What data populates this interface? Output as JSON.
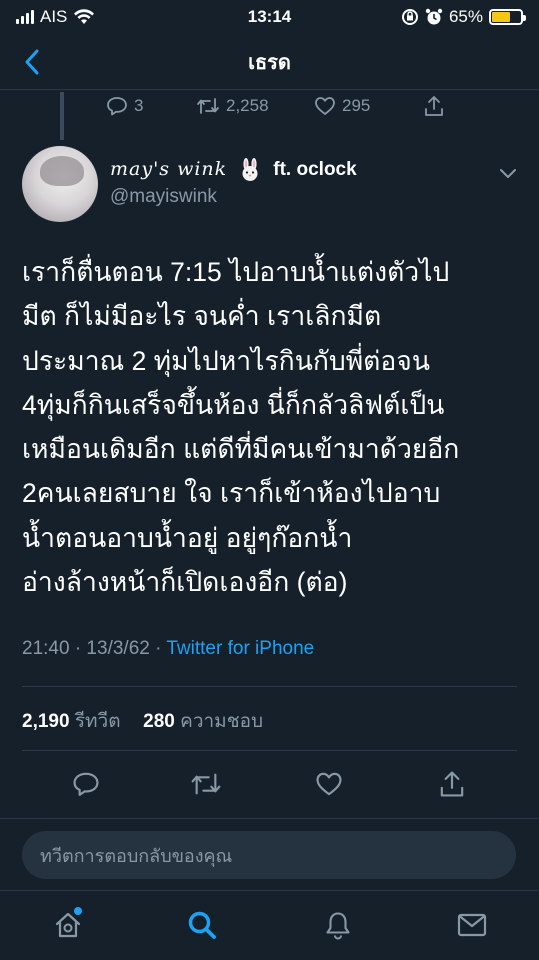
{
  "status_bar": {
    "carrier": "AIS",
    "time": "13:14",
    "battery_percent": "65%",
    "battery_level": 0.65,
    "battery_color": "#f5c518"
  },
  "nav": {
    "title": "เธรด",
    "back_icon": "chevron-left-icon"
  },
  "previous_tweet": {
    "replies": "3",
    "retweets": "2,258",
    "likes": "295"
  },
  "tweet": {
    "display_name": "may's wink",
    "display_name_suffix": "ft. oclock",
    "emoji": "rabbit-icon",
    "handle": "@mayiswink",
    "text": "เราก็ตื่นตอน 7:15 ไปอาบน้ำแต่งตัวไป\nมีต ก็ไม่มีอะไร จนค่ำ เราเลิกมีต\nประมาณ 2 ทุ่มไปหาไรกินกับพี่ต่อจน\n4ทุ่มก็กินเสร็จขึ้นห้อง นี่ก็กลัวลิฟต์เป็น\nเหมือนเดิมอีก แต่ดีที่มีคนเข้ามาด้วยอีก\n2คนเลยสบาย ใจ เราก็เข้าห้องไปอาบ\nน้ำตอนอาบน้ำอยู่ อยู่ๆก๊อกน้ำ\nอ่างล้างหน้าก็เปิดเองอีก (ต่อ)",
    "time": "21:40 · 13/3/62 · ",
    "client": "Twitter for iPhone",
    "retweet_count": "2,190",
    "retweet_label": "รีทวีต",
    "like_count": "280",
    "like_label": "ความชอบ"
  },
  "reply_box": {
    "placeholder": "ทวีตการตอบกลับของคุณ"
  },
  "tab_bar": {
    "items": [
      "home-icon",
      "search-icon",
      "notifications-icon",
      "messages-icon"
    ],
    "active": "search-icon",
    "accent_color": "#1da1f2"
  }
}
